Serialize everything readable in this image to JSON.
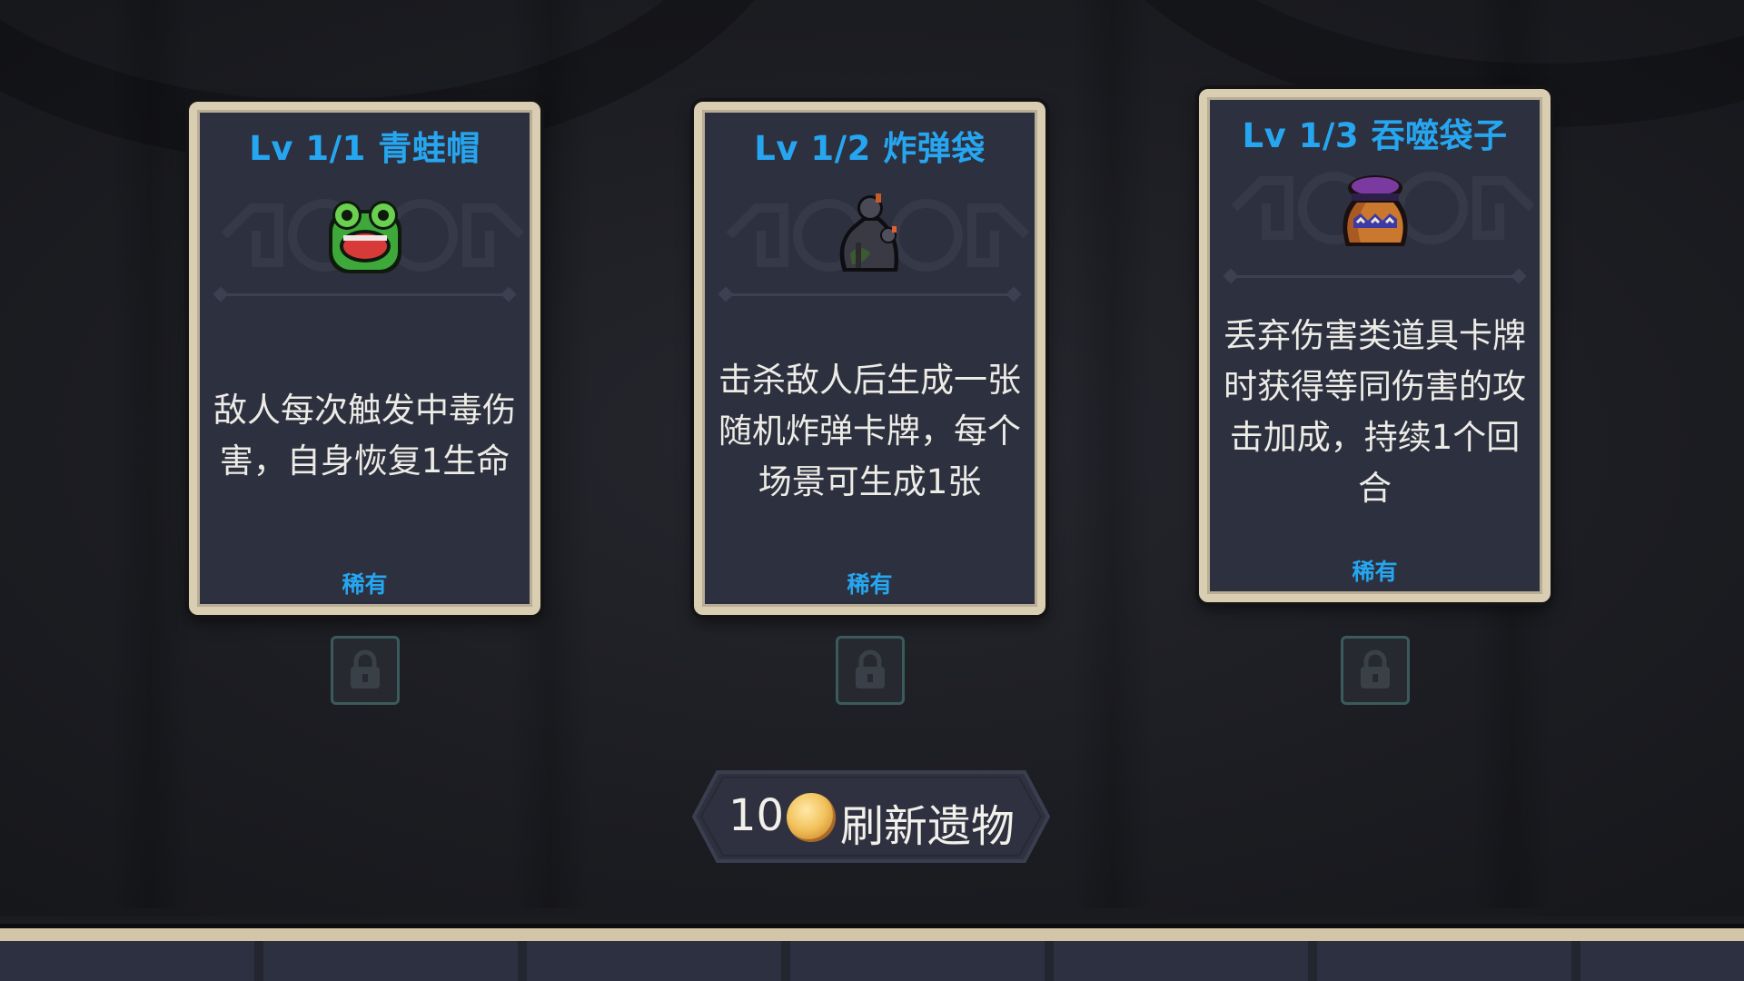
{
  "relics": [
    {
      "title": "Lv 1/1 青蛙帽",
      "description": "敌人每次触发中毒伤害，自身恢复1生命",
      "rarity": "稀有",
      "icon": "frog-hat-icon"
    },
    {
      "title": "Lv 1/2 炸弹袋",
      "description": "击杀敌人后生成一张随机炸弹卡牌，每个场景可生成1张",
      "rarity": "稀有",
      "icon": "bomb-bag-icon"
    },
    {
      "title": "Lv 1/3 吞噬袋子",
      "description": "丢弃伤害类道具卡牌时获得等同伤害的攻击加成，持续1个回合",
      "rarity": "稀有",
      "icon": "devouring-bag-icon"
    }
  ],
  "refresh": {
    "cost": "10",
    "label": "刷新遗物",
    "icon": "gold-coin-icon"
  },
  "colors": {
    "title_blue": "#26a6f0",
    "card_bg": "#2d303e",
    "card_border": "#d9cdb2"
  }
}
